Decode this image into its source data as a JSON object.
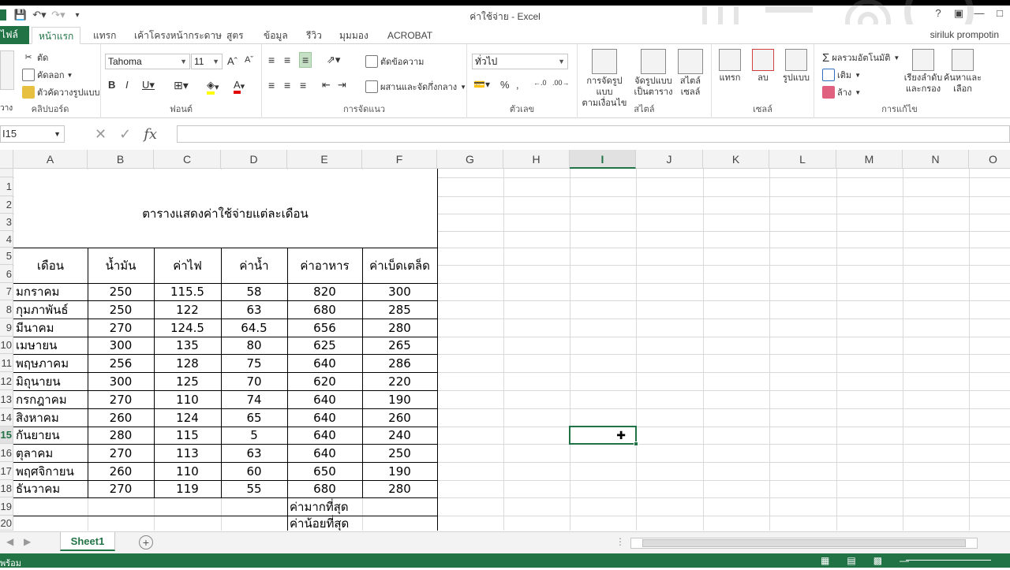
{
  "window": {
    "title": "ค่าใช้จ่าย - Excel",
    "user": "siriluk prompotin"
  },
  "tabs": [
    "ไฟล์",
    "หน้าแรก",
    "แทรก",
    "เค้าโครงหน้ากระดาษ",
    "สูตร",
    "ข้อมูล",
    "รีวิว",
    "มุมมอง",
    "ACROBAT"
  ],
  "ribbon": {
    "clipboard": {
      "cut": "ตัด",
      "copy": "คัดลอก",
      "painter": "ตัวคัดวางรูปแบบ",
      "paste": "วาง",
      "label": "คลิปบอร์ด"
    },
    "font": {
      "name": "Tahoma",
      "size": "11",
      "label": "ฟอนต์"
    },
    "alignment": {
      "wrap": "ตัดข้อความ",
      "merge": "ผสานและจัดกึ่งกลาง",
      "label": "การจัดแนว"
    },
    "number": {
      "format": "ทั่วไป",
      "label": "ตัวเลข"
    },
    "styles": {
      "cond1": "การจัดรูปแบบ",
      "cond2": "ตามเงื่อนไข",
      "table1": "จัดรูปแบบ",
      "table2": "เป็นตาราง",
      "cell1": "สไตล์",
      "cell2": "เซลล์",
      "label": "สไตล์"
    },
    "cells": {
      "insert": "แทรก",
      "delete": "ลบ",
      "format": "รูปแบบ",
      "label": "เซลล์"
    },
    "editing": {
      "autosum": "ผลรวมอัตโนมัติ",
      "fill": "เติม",
      "clear": "ล้าง",
      "sort1": "เรียงลำดับ",
      "sort2": "และกรอง",
      "find1": "ค้นหาและ",
      "find2": "เลือก",
      "label": "การแก้ไข"
    }
  },
  "formula_bar": {
    "name_box": "I15",
    "value": ""
  },
  "columns": [
    "A",
    "B",
    "C",
    "D",
    "E",
    "F",
    "G",
    "H",
    "I",
    "J",
    "K",
    "L",
    "M",
    "N",
    "O"
  ],
  "rows": [
    "1",
    "2",
    "3",
    "4",
    "5",
    "6",
    "7",
    "8",
    "9",
    "10",
    "11",
    "12",
    "13",
    "14",
    "15",
    "16",
    "17",
    "18",
    "19",
    "20"
  ],
  "sheet": {
    "title": "ตารางแสดงค่าใช้จ่ายแต่ละเดือน",
    "headers": [
      "เดือน",
      "น้ำมัน",
      "ค่าไฟ",
      "ค่าน้ำ",
      "ค่าอาหาร",
      "ค่าเบ็ดเตล็ด"
    ],
    "rows": [
      [
        "มกราคม",
        "250",
        "115.5",
        "58",
        "820",
        "300"
      ],
      [
        "กุมภาพันธ์",
        "250",
        "122",
        "63",
        "680",
        "285"
      ],
      [
        "มีนาคม",
        "270",
        "124.5",
        "64.5",
        "656",
        "280"
      ],
      [
        "เมษายน",
        "300",
        "135",
        "80",
        "625",
        "265"
      ],
      [
        "พฤษภาคม",
        "256",
        "128",
        "75",
        "640",
        "286"
      ],
      [
        "มิถุนายน",
        "300",
        "125",
        "70",
        "620",
        "220"
      ],
      [
        "กรกฎาคม",
        "270",
        "110",
        "74",
        "640",
        "190"
      ],
      [
        "สิงหาคม",
        "260",
        "124",
        "65",
        "640",
        "260"
      ],
      [
        "กันยายน",
        "280",
        "115",
        "5",
        "640",
        "240"
      ],
      [
        "ตุลาคม",
        "270",
        "113",
        "63",
        "640",
        "250"
      ],
      [
        "พฤศจิกายน",
        "260",
        "110",
        "60",
        "650",
        "190"
      ],
      [
        "ธันวาคม",
        "270",
        "119",
        "55",
        "680",
        "280"
      ]
    ],
    "max_label": "ค่ามากที่สุด",
    "min_label": "ค่าน้อยที่สุด"
  },
  "sheet_tab": "Sheet1",
  "status": "พร้อม",
  "colors": {
    "accent": "#217346"
  }
}
